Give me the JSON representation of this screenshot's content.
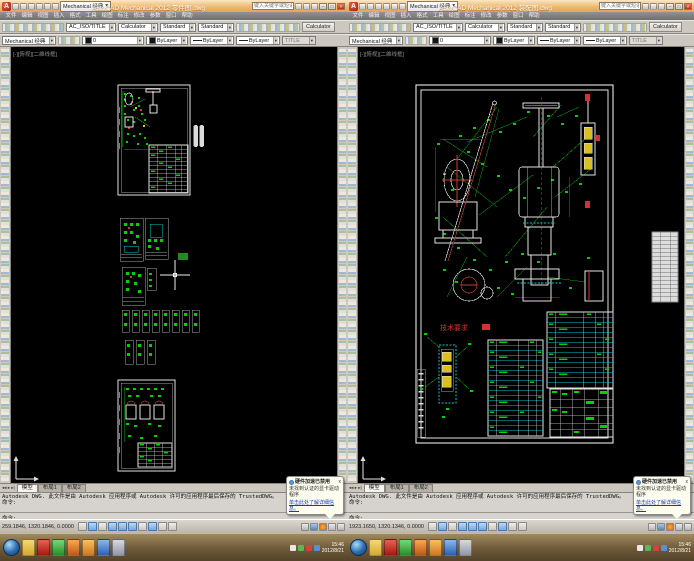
{
  "chrome": {
    "app_logo": "A",
    "workspace_combo": "Mechanical 经典",
    "menus": [
      "文件",
      "编辑",
      "视图",
      "插入",
      "格式",
      "工具",
      "绘图",
      "标注",
      "修改",
      "参数",
      "窗口",
      "帮助"
    ],
    "toolbar_row1": {
      "style_combo": "AC_ISO/TITLE",
      "calc_combo": "Calculator",
      "standard_combo_1": "Standard",
      "standard_combo_2": "Standard",
      "calculator_button": "Calculator"
    },
    "toolbar_row2": {
      "layer_combo": "0",
      "color_combo": "ByLayer",
      "linetype_combo": "ByLayer",
      "lineweight_combo": "ByLayer",
      "style_combo": "TITLE"
    },
    "infocenter_placeholder": "键入关键字或短语",
    "viewport_label": "[-][俯视][二维线框]",
    "tabs": {
      "model": "模型",
      "layout1": "布局1",
      "layout2": "布局2"
    },
    "command_history_1": "Autodesk DWG. 此文件是由 Autodesk 应用程序或 Autodesk 许可的应用程序最后保存的 TrustedDWG。",
    "command_history_2": "命令:",
    "command_prompt": "命令:",
    "balloon": {
      "title": "硬件加速已禁用",
      "body": "未找到认证的显卡驱动程序",
      "link": "单击此处了解详细信息。",
      "close": "x"
    }
  },
  "windows": {
    "left": {
      "title": "AutoCAD Mechanical 2012 零件图.dwg",
      "coords": "259.1846, 1320.1846, 0.0000"
    },
    "right": {
      "title": "AutoCAD Mechanical 2012 装配图.dwg",
      "coords": "1923.1650, 1320.1346, 0.0000"
    }
  },
  "taskbar": {
    "time": "15:46",
    "date": "2012/8/21"
  }
}
